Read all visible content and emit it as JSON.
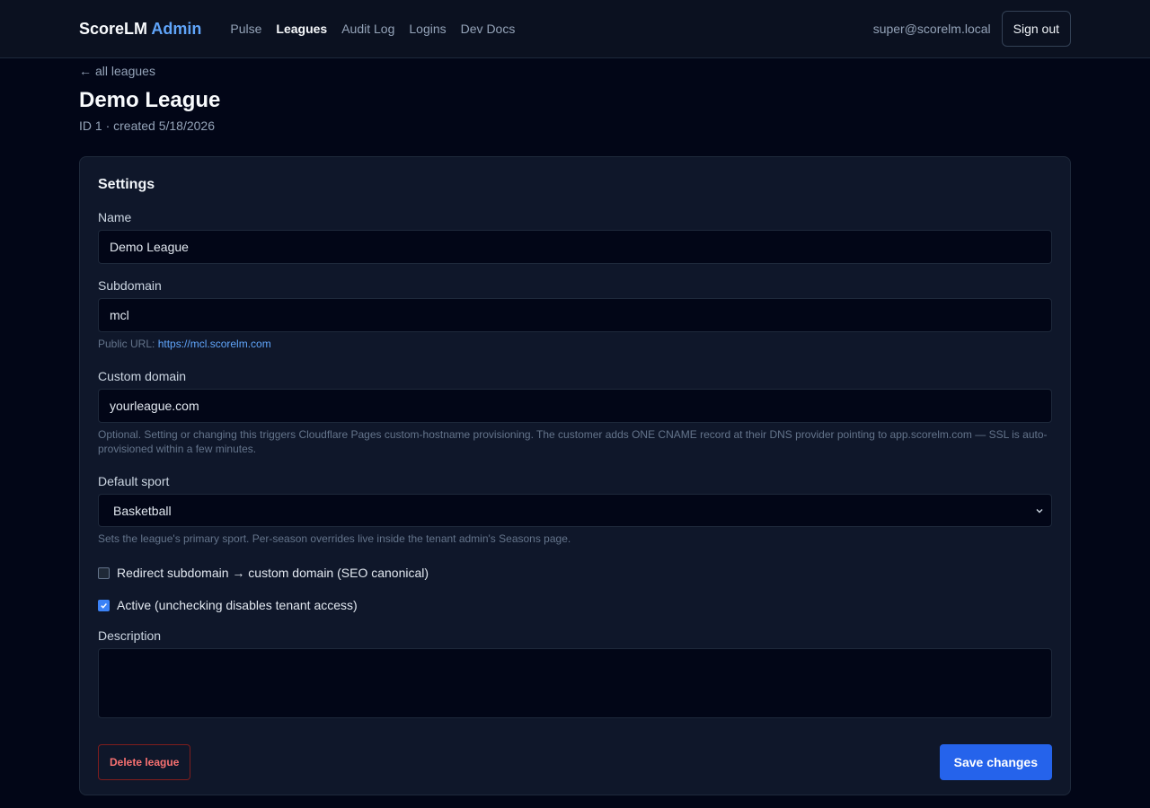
{
  "app": {
    "brand": "ScoreLM",
    "brand_accent": "Admin"
  },
  "nav": {
    "items": [
      {
        "label": "Pulse"
      },
      {
        "label": "Leagues",
        "active": true
      },
      {
        "label": "Audit Log"
      },
      {
        "label": "Logins"
      },
      {
        "label": "Dev Docs"
      }
    ]
  },
  "user": {
    "email": "super@scorelm.local",
    "signout_label": "Sign out"
  },
  "page": {
    "back_label": "all leagues",
    "title": "Demo League",
    "meta": "ID 1 · created 5/18/2026"
  },
  "settings": {
    "heading": "Settings",
    "name": {
      "label": "Name",
      "value": "Demo League"
    },
    "subdomain": {
      "label": "Subdomain",
      "value": "mcl",
      "help_prefix": "Public URL:",
      "public_url": "https://mcl.scorelm.com"
    },
    "custom_domain": {
      "label": "Custom domain",
      "value": "yourleague.com",
      "help": "Optional. Setting or changing this triggers Cloudflare Pages custom-hostname provisioning. The customer adds ONE CNAME record at their DNS provider pointing to app.scorelm.com — SSL is auto-provisioned within a few minutes."
    },
    "default_sport": {
      "label": "Default sport",
      "value": "Basketball",
      "help": "Sets the league's primary sport. Per-season overrides live inside the tenant admin's Seasons page."
    },
    "redirect": {
      "label": "Redirect subdomain → custom domain (SEO canonical)",
      "checked": false
    },
    "active": {
      "label": "Active (unchecking disables tenant access)",
      "checked": true
    },
    "description": {
      "label": "Description",
      "value": ""
    },
    "delete_label": "Delete league",
    "save_label": "Save changes"
  },
  "colors": {
    "background": "#020617",
    "card": "#0f172a",
    "accent": "#60a5fa",
    "primary_button": "#2563eb",
    "danger": "#f87171"
  }
}
